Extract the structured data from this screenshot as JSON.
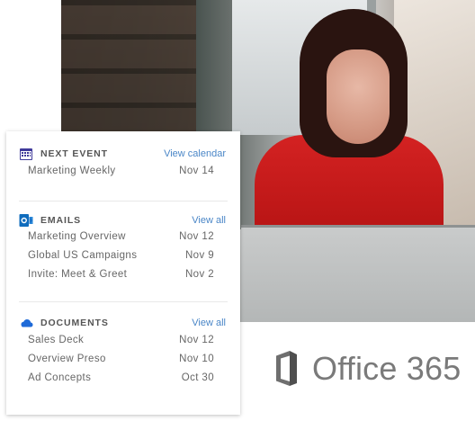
{
  "brand": {
    "product": "Office 365"
  },
  "card": {
    "next_event": {
      "title": "NEXT EVENT",
      "action": "View calendar",
      "items": [
        {
          "name": "Marketing Weekly",
          "date": "Nov 14"
        }
      ]
    },
    "emails": {
      "title": "EMAILS",
      "action": "View all",
      "items": [
        {
          "name": "Marketing Overview",
          "date": "Nov 12"
        },
        {
          "name": "Global US Campaigns",
          "date": "Nov 9"
        },
        {
          "name": "Invite: Meet & Greet",
          "date": "Nov 2"
        }
      ]
    },
    "documents": {
      "title": "DOCUMENTS",
      "action": "View all",
      "items": [
        {
          "name": "Sales Deck",
          "date": "Nov 12"
        },
        {
          "name": "Overview Preso",
          "date": "Nov 10"
        },
        {
          "name": "Ad Concepts",
          "date": "Oct 30"
        }
      ]
    }
  },
  "icons": {
    "calendar": "calendar-icon",
    "outlook": "outlook-icon",
    "onedrive": "cloud-icon",
    "office": "office-logo-icon"
  },
  "colors": {
    "accent_blue": "#4a86c7",
    "outlook_blue": "#0f6cbd",
    "onedrive_blue": "#1e6ad8",
    "text_gray": "#666666",
    "wordmark_gray": "#7a7a7a"
  }
}
